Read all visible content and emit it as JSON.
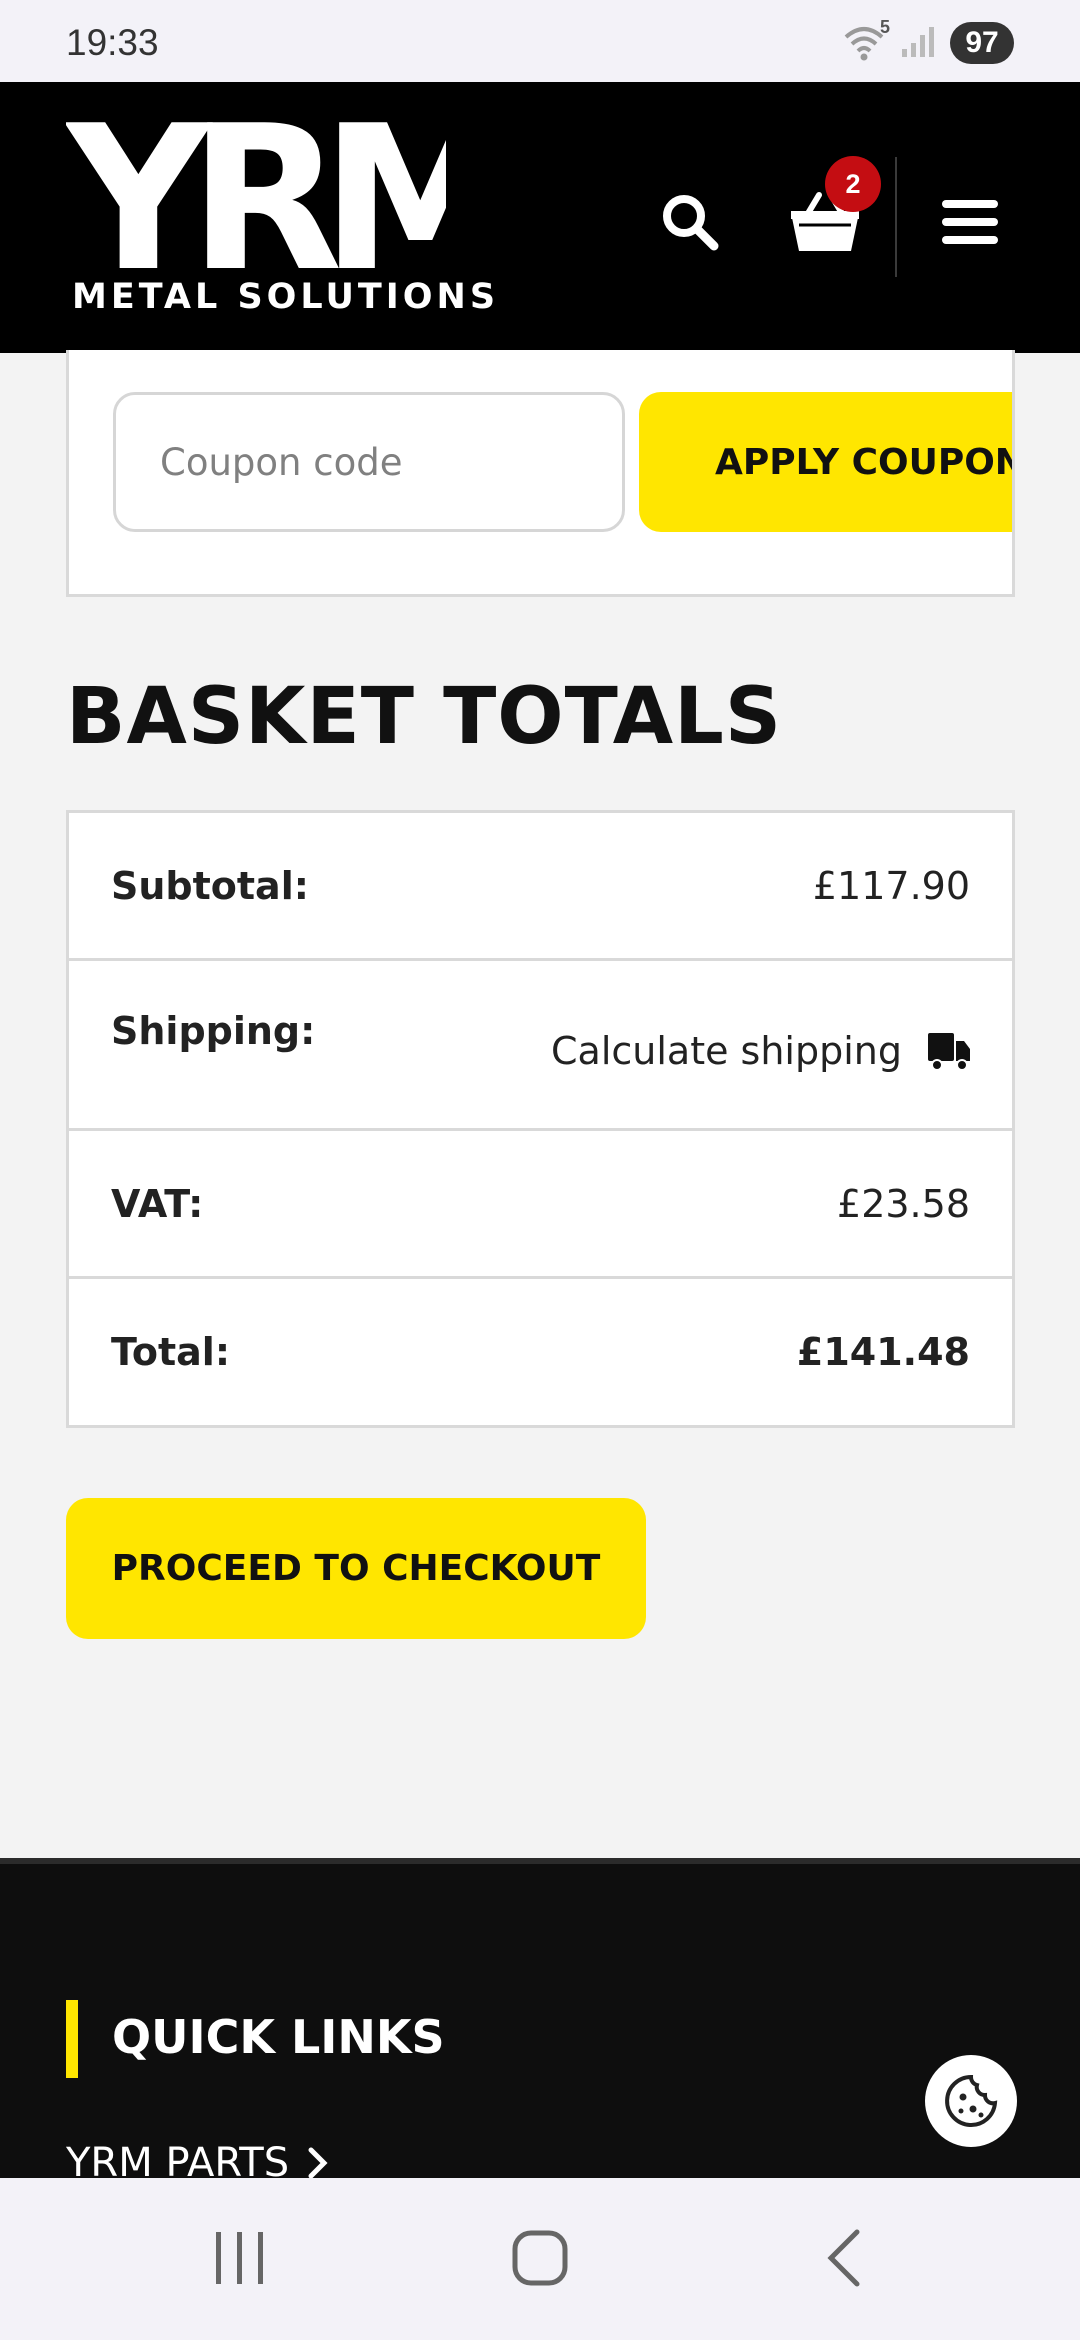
{
  "status_bar": {
    "time": "19:33",
    "wifi_badge": "5",
    "battery": "97"
  },
  "header": {
    "logo_text": "YRM",
    "logo_subtitle": "METAL SOLUTIONS",
    "cart_count": "2",
    "icons": [
      "search-icon",
      "basket-icon",
      "hamburger-menu-icon"
    ]
  },
  "coupon": {
    "placeholder": "Coupon code",
    "apply_label": "APPLY COUPON"
  },
  "totals": {
    "title": "BASKET TOTALS",
    "subtotal_label": "Subtotal:",
    "subtotal_value": "£117.90",
    "shipping_label": "Shipping:",
    "shipping_link": "Calculate shipping",
    "vat_label": "VAT:",
    "vat_value": "£23.58",
    "total_label": "Total:",
    "total_value": "£141.48"
  },
  "checkout": {
    "label": "PROCEED TO CHECKOUT"
  },
  "footer": {
    "quick_links_title": "QUICK LINKS",
    "first_link": "YRM PARTS"
  },
  "colors": {
    "accent": "#ffe600",
    "header_bg": "#000000",
    "badge": "#c40d12",
    "footer_bg": "#0e0e0e"
  }
}
